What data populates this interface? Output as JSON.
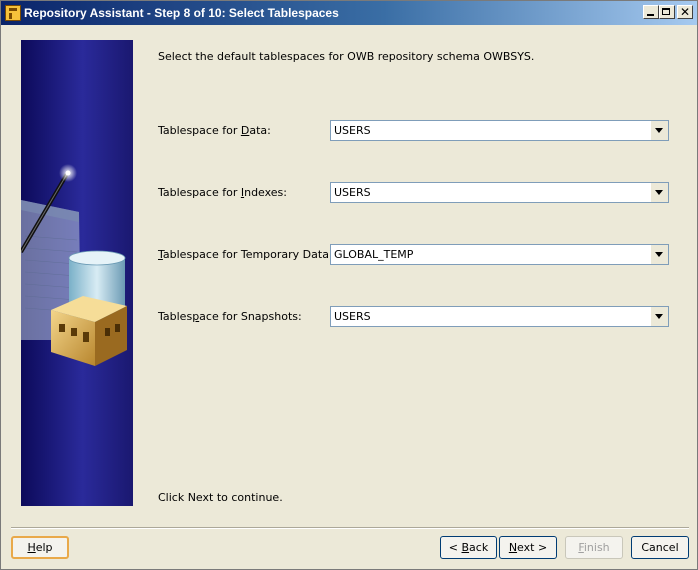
{
  "window": {
    "title": "Repository Assistant - Step 8 of 10: Select Tablespaces",
    "controls": [
      "minimize",
      "maximize",
      "close"
    ]
  },
  "main": {
    "intro": "Select the default tablespaces for OWB repository schema OWBSYS.",
    "fields": [
      {
        "pre": "Tablespace for ",
        "key": "D",
        "post": "ata:",
        "value": "USERS"
      },
      {
        "pre": "Tablespace for ",
        "key": "I",
        "post": "ndexes:",
        "value": "USERS"
      },
      {
        "pre": "",
        "key": "T",
        "post": "ablespace for Temporary Data:",
        "value": "GLOBAL_TEMP"
      },
      {
        "pre": "Tables",
        "key": "p",
        "post": "ace for Snapshots:",
        "value": "USERS"
      }
    ],
    "footer_hint": "Click Next to continue."
  },
  "buttons": {
    "help": {
      "key": "H",
      "rest": "elp"
    },
    "back": {
      "pre": "< ",
      "key": "B",
      "rest": "ack"
    },
    "next": {
      "key": "N",
      "rest": "ext >"
    },
    "finish": {
      "key": "F",
      "rest": "inish",
      "enabled": false
    },
    "cancel": {
      "label": "Cancel"
    }
  },
  "colors": {
    "title_gradient_start": "#0a246a",
    "title_gradient_end": "#a6caf0",
    "side_panel": "#1a1870",
    "window_bg": "#ECE9D8"
  }
}
